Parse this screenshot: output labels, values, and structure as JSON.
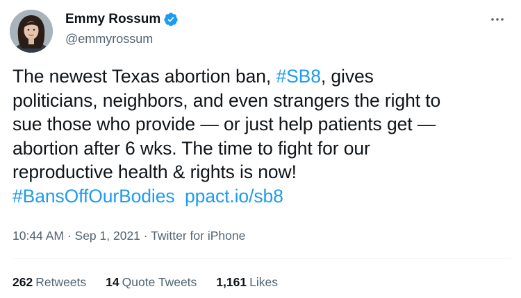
{
  "colors": {
    "accent": "#1d9bf0",
    "text": "#0f1419",
    "secondary": "#536471",
    "divider": "#eff3f4"
  },
  "author": {
    "display_name": "Emmy Rossum",
    "handle": "@emmyrossum",
    "verified_icon": "verified-badge-icon",
    "more_icon": "more-dots-icon"
  },
  "tweet": {
    "lines": [
      {
        "t1": "The newest Texas abortion ban, ",
        "link": "#SB8",
        "t2": ", gives"
      },
      {
        "text": "politicians, neighbors, and even strangers the right to"
      },
      {
        "text": "sue those who provide — or just help patients get —"
      },
      {
        "text": "abortion after 6 wks. The time to fight for our"
      },
      {
        "text": "reproductive health & rights is now!"
      }
    ],
    "hashtag": "#BansOffOurBodies",
    "url": "ppact.io/sb8"
  },
  "meta": {
    "time": "10:44 AM",
    "sep1": " · ",
    "date": "Sep 1, 2021",
    "sep2": " · ",
    "source": "Twitter for iPhone"
  },
  "stats": {
    "retweets": {
      "count": "262",
      "label": "Retweets"
    },
    "quotes": {
      "count": "14",
      "label": "Quote Tweets"
    },
    "likes": {
      "count": "1,161",
      "label": "Likes"
    }
  }
}
